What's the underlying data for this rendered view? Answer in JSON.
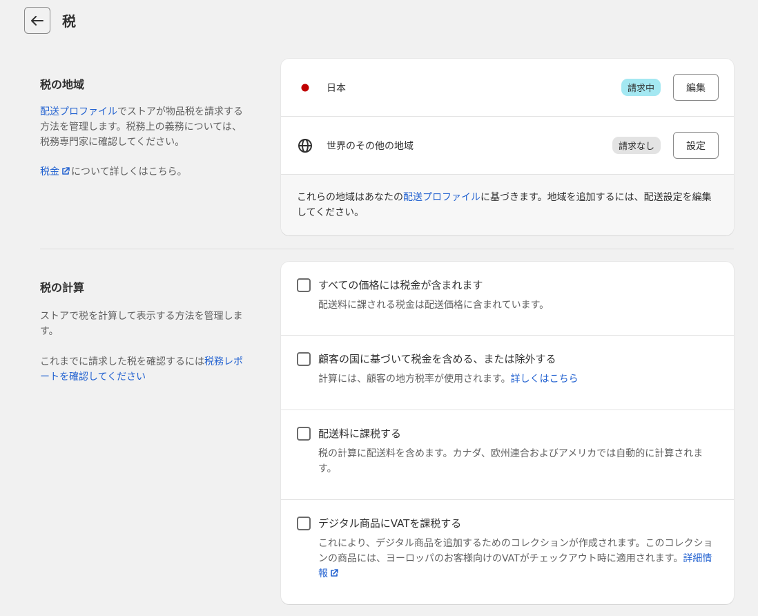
{
  "header": {
    "title": "税"
  },
  "tax_regions": {
    "title": "税の地域",
    "desc_link": "配送プロファイル",
    "desc_text": "でストアが物品税を請求する方法を管理します。税務上の義務については、税務専門家に確認してください。",
    "learn_link": "税金",
    "learn_text": "について詳しくはこちら。",
    "regions": [
      {
        "name": "日本",
        "badge": "請求中",
        "button": "編集",
        "icon": "red-dot-icon"
      },
      {
        "name": "世界のその他の地域",
        "badge": "請求なし",
        "button": "設定",
        "icon": "globe-icon"
      }
    ],
    "note_prefix": "これらの地域はあなたの",
    "note_link": "配送プロファイル",
    "note_suffix": "に基づきます。地域を追加するには、配送設定を編集してください。"
  },
  "tax_calc": {
    "title": "税の計算",
    "desc": "ストアで税を計算して表示する方法を管理します。",
    "report_prefix": "これまでに請求した税を確認するには",
    "report_link": "税務レポートを確認してください",
    "options": [
      {
        "label": "すべての価格には税金が含まれます",
        "desc": "配送料に課される税金は配送価格に含まれています。",
        "link": "",
        "checked": false
      },
      {
        "label": "顧客の国に基づいて税金を含める、または除外する",
        "desc": "計算には、顧客の地方税率が使用されます。",
        "link": "詳しくはこちら",
        "checked": false
      },
      {
        "label": "配送料に課税する",
        "desc": "税の計算に配送料を含めます。カナダ、欧州連合およびアメリカでは自動的に計算されます。",
        "link": "",
        "checked": false
      },
      {
        "label": "デジタル商品にVATを課税する",
        "desc": "これにより、デジタル商品を追加するためのコレクションが作成されます。このコレクションの商品には、ヨーロッパのお客様向けのVATがチェックアウト時に適用されます。",
        "link": "詳細情報",
        "checked": false
      }
    ]
  },
  "colors": {
    "accent": "#2463d1",
    "badge_active": "#a4e8f2",
    "badge_inactive": "#e3e3e3",
    "japan_dot": "#c00000"
  }
}
